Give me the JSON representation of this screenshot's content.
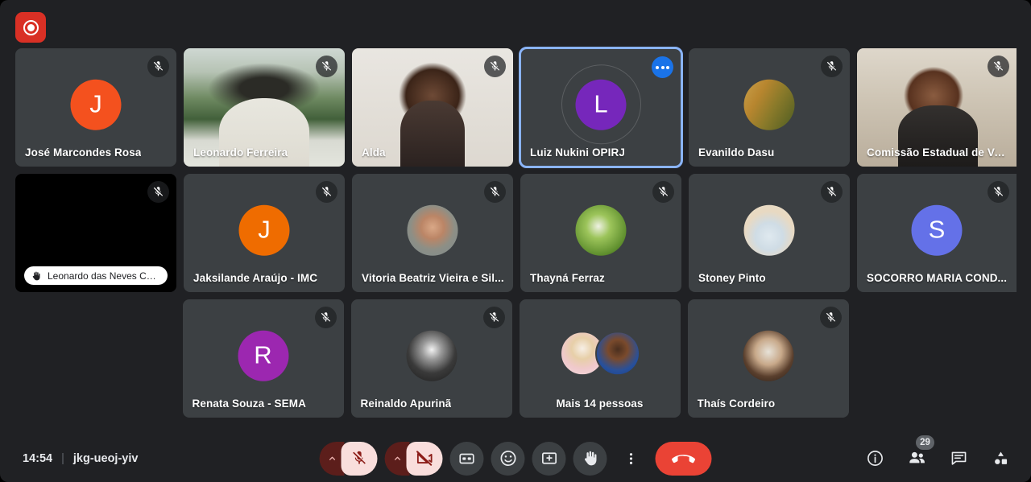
{
  "app": {
    "name": "Google Meet",
    "background_color": "#202124",
    "tile_color": "#3c4043",
    "accent_blue": "#8ab4f8"
  },
  "recording_badge": {
    "icon": "record-icon",
    "color": "#d93025"
  },
  "grid": {
    "rows": [
      {
        "tiles": [
          {
            "name": "José Marcondes Rosa",
            "type": "avatar-letter",
            "letter": "J",
            "color": "#f4511e",
            "muted": true,
            "active": false
          },
          {
            "name": "Leonardo Ferreira",
            "type": "video",
            "video": "vid-leonardo",
            "muted": true,
            "active": false
          },
          {
            "name": "Alda",
            "type": "video",
            "video": "vid-alda",
            "muted": true,
            "active": false
          },
          {
            "name": "Luiz Nukini OPIRJ",
            "type": "avatar-letter",
            "letter": "L",
            "color": "#7627bb",
            "muted": false,
            "active": true,
            "more_options": true
          },
          {
            "name": "Evanildo Dasu",
            "type": "avatar-photo",
            "photo": "ph-evanildo",
            "muted": true,
            "active": false
          },
          {
            "name": "Comissão Estadual de Va...",
            "type": "video",
            "video": "vid-comissao",
            "muted": true,
            "active": false,
            "clipped": true
          }
        ]
      },
      {
        "tiles": [
          {
            "name": "Leonardo das Neves Ca...",
            "type": "camera-off",
            "muted": true,
            "active": false,
            "pill": true,
            "hand_raised": true
          },
          {
            "name": "Jaksilande Araújo - IMC",
            "type": "avatar-letter",
            "letter": "J",
            "color": "#ef6c00",
            "muted": true,
            "active": false
          },
          {
            "name": "Vitoria Beatriz Vieira e Sil...",
            "type": "avatar-photo",
            "photo": "ph-vitoria",
            "muted": true,
            "active": false
          },
          {
            "name": "Thayná Ferraz",
            "type": "avatar-photo",
            "photo": "ph-thayna",
            "muted": true,
            "active": false
          },
          {
            "name": "Stoney Pinto",
            "type": "avatar-photo",
            "photo": "ph-stoney",
            "muted": true,
            "active": false
          },
          {
            "name": "SOCORRO MARIA COND...",
            "type": "avatar-letter",
            "letter": "S",
            "color": "#6471e8",
            "muted": true,
            "active": false,
            "clipped": true
          }
        ]
      },
      {
        "tiles": [
          {
            "name": "Renata Souza - SEMA",
            "type": "avatar-letter",
            "letter": "R",
            "color": "#9c27b0",
            "muted": true,
            "active": false
          },
          {
            "name": "Reinaldo Apurinã",
            "type": "avatar-photo",
            "photo": "ph-reinaldo",
            "muted": true,
            "active": false
          },
          {
            "name": "Mais 14 pessoas",
            "type": "overflow",
            "muted": false,
            "active": false,
            "name_centered": true
          },
          {
            "name": "Thaís Cordeiro",
            "type": "avatar-photo",
            "photo": "ph-thais",
            "muted": true,
            "active": false
          }
        ]
      }
    ]
  },
  "bottom_bar": {
    "time": "14:54",
    "separator": "|",
    "meeting_code": "jkg-ueoj-yiv",
    "controls": [
      {
        "name": "microphone-expand",
        "icon": "chevron-up-icon"
      },
      {
        "name": "microphone-toggle",
        "icon": "mic-off-icon",
        "state": "muted"
      },
      {
        "name": "camera-expand",
        "icon": "chevron-up-icon"
      },
      {
        "name": "camera-toggle",
        "icon": "camera-off-icon",
        "state": "off"
      },
      {
        "name": "captions-toggle",
        "icon": "closed-captions-icon"
      },
      {
        "name": "reactions",
        "icon": "emoji-icon"
      },
      {
        "name": "present-screen",
        "icon": "present-screen-icon"
      },
      {
        "name": "raise-hand",
        "icon": "raised-hand-icon"
      },
      {
        "name": "more-options",
        "icon": "more-vertical-icon"
      },
      {
        "name": "leave-call",
        "icon": "end-call-icon"
      }
    ],
    "right_controls": [
      {
        "name": "meeting-details",
        "icon": "info-icon"
      },
      {
        "name": "people-panel",
        "icon": "people-icon",
        "badge": "29"
      },
      {
        "name": "chat-panel",
        "icon": "chat-icon"
      },
      {
        "name": "activities-panel",
        "icon": "activities-icon"
      }
    ]
  }
}
